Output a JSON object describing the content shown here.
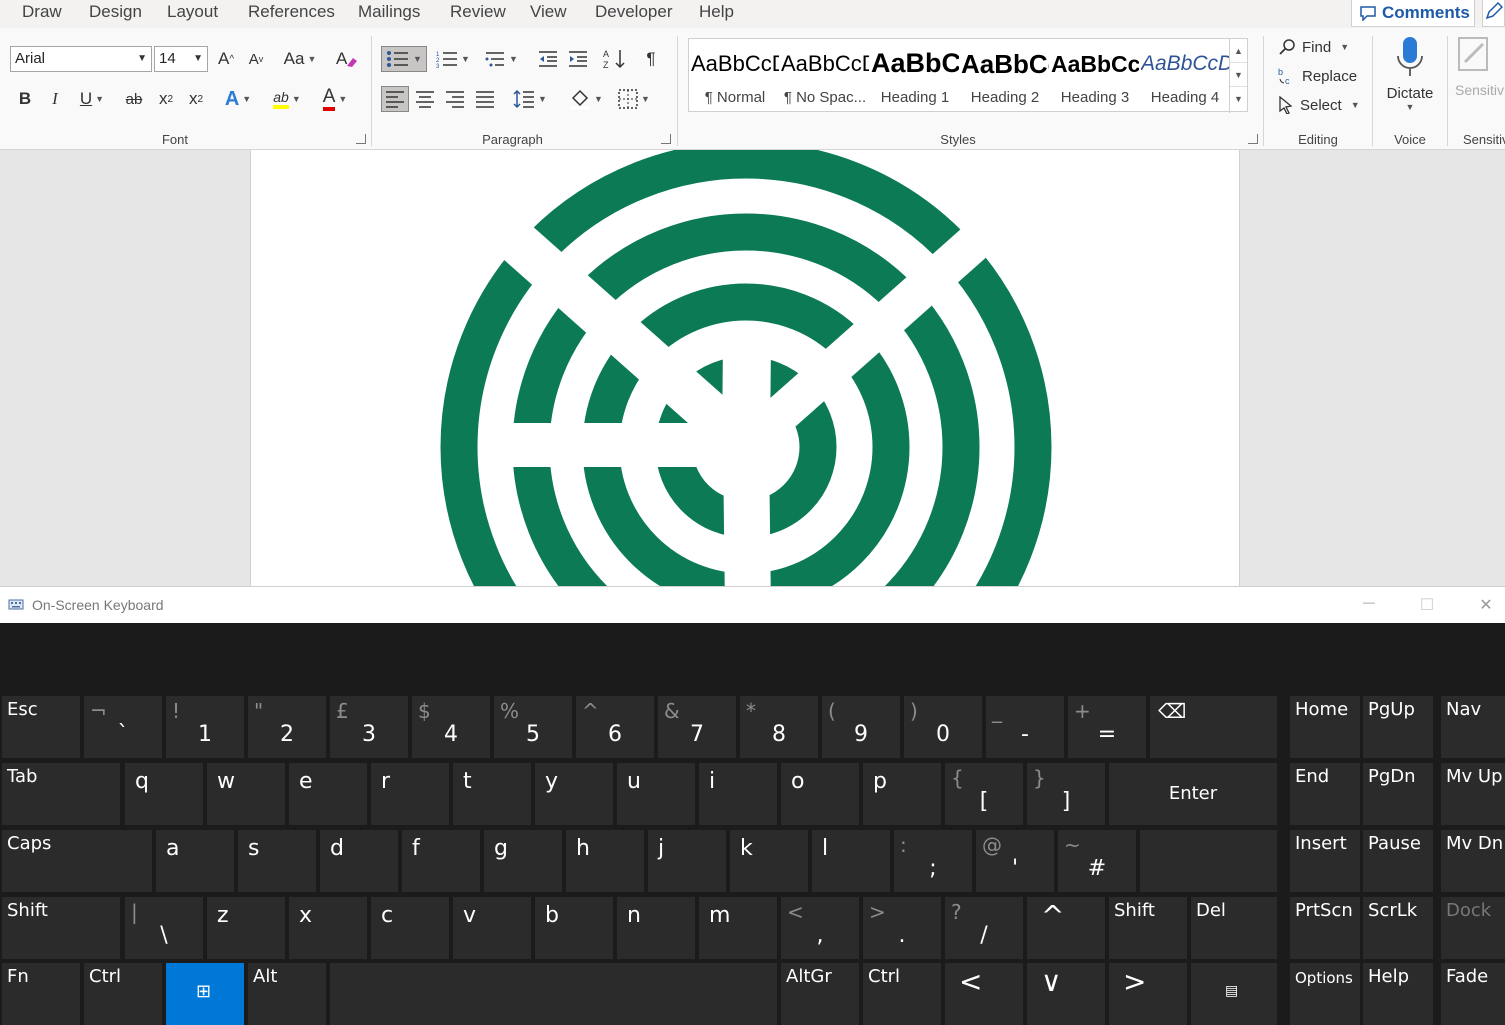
{
  "tabs": [
    "Draw",
    "Design",
    "Layout",
    "References",
    "Mailings",
    "Review",
    "View",
    "Developer",
    "Help"
  ],
  "comments_label": "Comments",
  "font": {
    "group_label": "Font",
    "font_name": "Arial",
    "font_size": "14",
    "grow_label": "A",
    "shrink_label": "A",
    "case_label": "Aa",
    "bold": "B",
    "italic": "I",
    "underline": "U",
    "strike": "ab",
    "subscript": "x",
    "superscript": "x",
    "effects": "A",
    "highlight": "ab",
    "color": "A",
    "highlight_color": "#ffff00",
    "font_color": "#e00000"
  },
  "paragraph": {
    "group_label": "Paragraph",
    "pilcrow": "¶"
  },
  "styles": {
    "group_label": "Styles",
    "items": [
      {
        "sample": "AaBbCcDc",
        "name": "¶ Normal"
      },
      {
        "sample": "AaBbCcDc",
        "name": "¶ No Spac..."
      },
      {
        "sample": "AaBbC",
        "name": "Heading 1"
      },
      {
        "sample": "AaBbCc",
        "name": "Heading 2"
      },
      {
        "sample": "AaBbCcI",
        "name": "Heading 3"
      },
      {
        "sample": "AaBbCcDc",
        "name": "Heading 4"
      }
    ]
  },
  "editing": {
    "group_label": "Editing",
    "find": "Find",
    "replace": "Replace",
    "select": "Select"
  },
  "voice": {
    "group_label": "Voice",
    "dictate": "Dictate"
  },
  "sensitivity": {
    "group_label": "Sensitiv",
    "button": "Sensitiv"
  },
  "document": {
    "logo_color": "#0b7a55"
  },
  "osk": {
    "title": "On-Screen Keyboard",
    "minimize": "—",
    "maximize": "☐",
    "close": "✕",
    "row1": [
      {
        "shift": "",
        "main": "",
        "label": "Esc"
      },
      {
        "shift": "¬",
        "main": "`"
      },
      {
        "shift": "!",
        "main": "1"
      },
      {
        "shift": "\"",
        "main": "2"
      },
      {
        "shift": "£",
        "main": "3"
      },
      {
        "shift": "$",
        "main": "4"
      },
      {
        "shift": "%",
        "main": "5"
      },
      {
        "shift": "^",
        "main": "6"
      },
      {
        "shift": "&",
        "main": "7"
      },
      {
        "shift": "*",
        "main": "8"
      },
      {
        "shift": "(",
        "main": "9"
      },
      {
        "shift": ")",
        "main": "0"
      },
      {
        "shift": "_",
        "main": "-"
      },
      {
        "shift": "+",
        "main": "="
      },
      {
        "label": "⌫"
      }
    ],
    "row2": [
      {
        "label": "Tab"
      },
      {
        "letter": "q"
      },
      {
        "letter": "w"
      },
      {
        "letter": "e"
      },
      {
        "letter": "r"
      },
      {
        "letter": "t"
      },
      {
        "letter": "y"
      },
      {
        "letter": "u"
      },
      {
        "letter": "i"
      },
      {
        "letter": "o"
      },
      {
        "letter": "p"
      },
      {
        "shift": "{",
        "main": "["
      },
      {
        "shift": "}",
        "main": "]"
      },
      {
        "label": "Enter"
      }
    ],
    "row3": [
      {
        "label": "Caps"
      },
      {
        "letter": "a"
      },
      {
        "letter": "s"
      },
      {
        "letter": "d"
      },
      {
        "letter": "f"
      },
      {
        "letter": "g"
      },
      {
        "letter": "h"
      },
      {
        "letter": "j"
      },
      {
        "letter": "k"
      },
      {
        "letter": "l"
      },
      {
        "shift": ":",
        "main": ";"
      },
      {
        "shift": "@",
        "main": "'"
      },
      {
        "shift": "~",
        "main": "#"
      }
    ],
    "row4": [
      {
        "label": "Shift"
      },
      {
        "shift": "|",
        "main": "\\"
      },
      {
        "letter": "z"
      },
      {
        "letter": "x"
      },
      {
        "letter": "c"
      },
      {
        "letter": "v"
      },
      {
        "letter": "b"
      },
      {
        "letter": "n"
      },
      {
        "letter": "m"
      },
      {
        "shift": "<",
        "main": ","
      },
      {
        "shift": ">",
        "main": "."
      },
      {
        "shift": "?",
        "main": "/"
      },
      {
        "label": "^"
      },
      {
        "label": "Shift"
      },
      {
        "label": "Del"
      }
    ],
    "row5": [
      {
        "label": "Fn"
      },
      {
        "label": "Ctrl"
      },
      {
        "label": "⊞"
      },
      {
        "label": "Alt"
      },
      {
        "label": ""
      },
      {
        "label": "AltGr"
      },
      {
        "label": "Ctrl"
      },
      {
        "label": "<"
      },
      {
        "label": "∨"
      },
      {
        "label": ">"
      },
      {
        "label": "▤"
      }
    ],
    "nav": [
      [
        "Home",
        "PgUp",
        "Nav"
      ],
      [
        "End",
        "PgDn",
        "Mv Up"
      ],
      [
        "Insert",
        "Pause",
        "Mv Dn"
      ],
      [
        "PrtScn",
        "ScrLk",
        "Dock"
      ],
      [
        "Options",
        "Help",
        "Fade"
      ]
    ]
  }
}
